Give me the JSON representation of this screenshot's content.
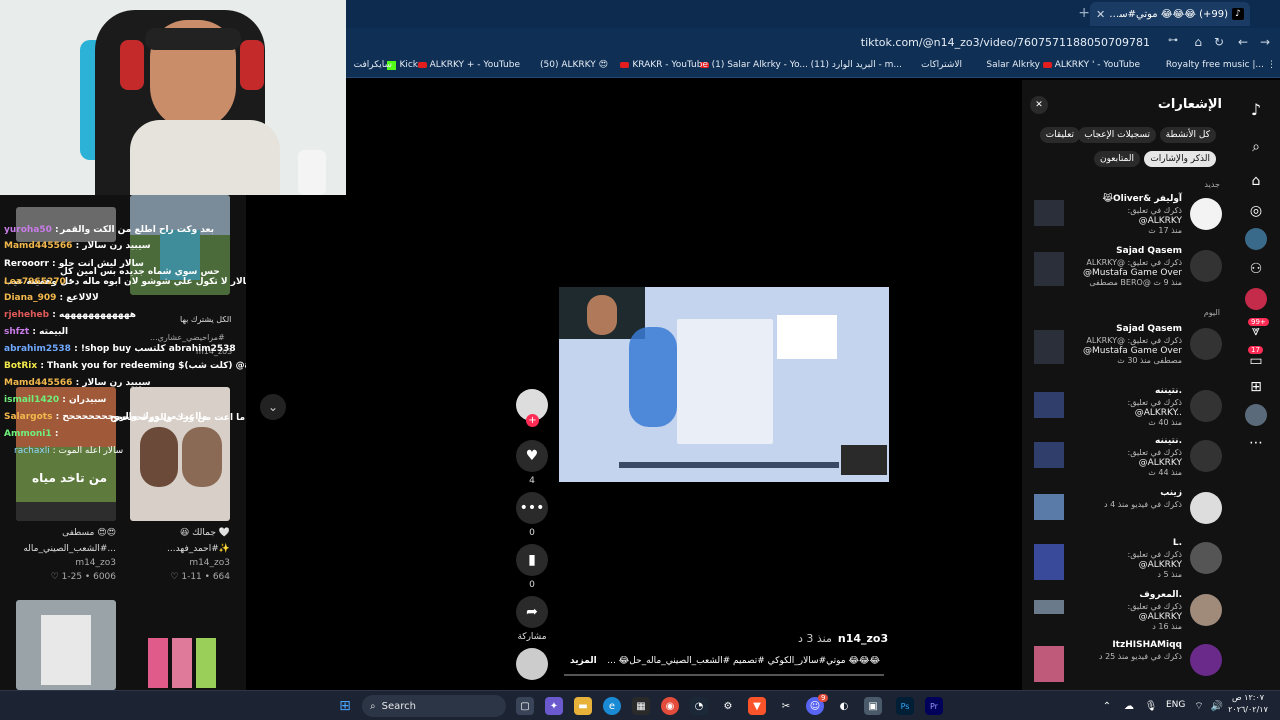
{
  "browser": {
    "tab_title": "(99+) 😂😂😂 موتي#سالار_الكوكي",
    "tab_close": "✕",
    "new_tab": "+",
    "url": "tiktok.com/@n14_zo3/video/7607571188050709781",
    "bookmarks": [
      "Royalty free music |...",
      "ALKRKY ' - YouTube",
      "Salar Alkrky",
      "الاشتراكات",
      "البريد الوارد (11) - m...",
      "(1) Salar Alkrky - Yo...",
      "KRAKR - YouTube",
      "(50) ALKRKY 😍",
      "ALKRKY + - YouTube",
      "Kick",
      "سايكرافت"
    ]
  },
  "left_pane": {
    "thumb_captions": [
      {
        "line1": "🤍 جمالك 😆",
        "line2": "✨#احمد_فهد...",
        "user": "m14_zo3",
        "stats": "664 • 1-11 ♡"
      },
      {
        "line1": "😍😍 مسطفى",
        "line2": "...#الشعب_الصيني_ماله",
        "user": "m14_zo3",
        "stats": "6006 • 1-25 ♡"
      }
    ],
    "mid_caption": "الكل يشترك بها",
    "mid_caption2": "#مراحيضي_عشاري...",
    "mid_user": "m14_zo3",
    "overlay_texts": [
      "بعد وكت راح اطلع من الكت والقمر",
      "حس سوي شماه جديده بس امين كل",
      "سالار لا تكول علي شوشو لان ابوه ماله دخل وهميته عيب",
      "ما اعت من ورك والروحححححح",
      "من تاخد مياه"
    ],
    "chat": [
      {
        "user": "yuroha50",
        "msg": ":",
        "color": "#c87ce8"
      },
      {
        "user": "Mamd445566",
        "msg": ": سيبيد رن سالار",
        "color": "#f2b84b"
      },
      {
        "user": "Rerooorr",
        "msg": ": سالار ليش انت حلو",
        "color": "#ffffff"
      },
      {
        "user": "Lea7965270",
        "msg": ":",
        "color": "#f2b84b"
      },
      {
        "user": "Diana_909",
        "msg": ": لالالاعع",
        "color": "#f2b84b"
      },
      {
        "user": "rjeheheb",
        "msg": ": ههههههههههههه",
        "color": "#e05a5a"
      },
      {
        "user": "shfzt",
        "msg": ": البيمته",
        "color": "#c87ce8"
      },
      {
        "user": "abrahim2538",
        "msg": ": !shop buy كلتسب abrahim2538",
        "color": "#6fa8ff"
      },
      {
        "user": "BotRix",
        "msg": ": Thank you for redeeming $(كلت شب) @abrahim2538",
        "color": "#f2e84b"
      },
      {
        "user": "Mamd445566",
        "msg": ": سيبيد رن سالار",
        "color": "#f2b84b"
      },
      {
        "user": "ismail1420",
        "msg": ": سبيدران",
        "color": "#6ff07a"
      },
      {
        "user": "Salargots",
        "msg": ": مااعت من ورك والروحححححححح",
        "color": "#f2b84b"
      },
      {
        "user": "Ammoni1",
        "msg": ":",
        "color": "#6ff07a"
      },
      {
        "user": "rachaxli",
        "msg": ": سالار اعله الموت",
        "color": "#8fd6ff"
      }
    ]
  },
  "player": {
    "likes": "4",
    "comments": "0",
    "saves": "0",
    "share_label": "مشاركة",
    "author": "n14_zo3",
    "time": "منذ 3 د",
    "description": "😂😂😂 موتي#سالار_الكوكي #تصميم #الشعب_الصيني_ماله_حل😂 ...",
    "more": "المزيد"
  },
  "notifications": {
    "title": "الإشعارات",
    "close": "✕",
    "filters": [
      "كل الأنشطة",
      "تسجيلات الإعجاب",
      "تعليقات",
      "الذكر والإشارات",
      "المتابعون"
    ],
    "section_new": "جديد",
    "section_today": "اليوم",
    "items": [
      {
        "name": "😹Oliver& آوليفر",
        "l2": "ذكرك في تعليق:",
        "l3": "@ALKRKY",
        "l4": "منذ 17 ث"
      },
      {
        "name": "Sajad Qasem",
        "l2": "ذكرك في تعليق: @ALKRKY",
        "l3": "@Mustafa Game Over",
        "l4": "مصطفى BERO@ منذ 9 ث"
      },
      {
        "name": "Sajad Qasem",
        "l2": "ذكرك في تعليق: @ALKRKY",
        "l3": "@Mustafa Game Over",
        "l4": "مصطفى منذ 30 ث"
      },
      {
        "name": "نتيننه.",
        "l2": "ذكرك في تعليق:",
        "l3": "@ALKRKY..",
        "l4": "منذ 40 ث"
      },
      {
        "name": "نتيننه.",
        "l2": "ذكرك في تعليق:",
        "l3": "@ALKRKY",
        "l4": "منذ 44 ث"
      },
      {
        "name": "زينب",
        "l2": "ذكرك في فيديو منذ 4 د",
        "l3": "",
        "l4": ""
      },
      {
        "name": "L.",
        "l2": "ذكرك في تعليق:",
        "l3": "@ALKRKY",
        "l4": "منذ 5 د"
      },
      {
        "name": "المعروف.",
        "l2": "ذكرك في تعليق:",
        "l3": "@ALKRKY",
        "l4": "منذ 16 د"
      },
      {
        "name": "ItzHISHAMiqq",
        "l2": "ذكرك في فيديو منذ 25 د",
        "l3": "",
        "l4": ""
      }
    ]
  },
  "rail": {
    "badges": [
      "99+",
      "17"
    ]
  },
  "taskbar": {
    "search": "Search",
    "lang": "ENG",
    "time": "١٢:٠٧ ص",
    "date": "٢٠٢٦/٠٢/١٧",
    "discord_badge": "9"
  },
  "colors": {
    "accent": "#fe2c55",
    "tiktok_blue": "#25f4ee",
    "panel": "#121212"
  }
}
